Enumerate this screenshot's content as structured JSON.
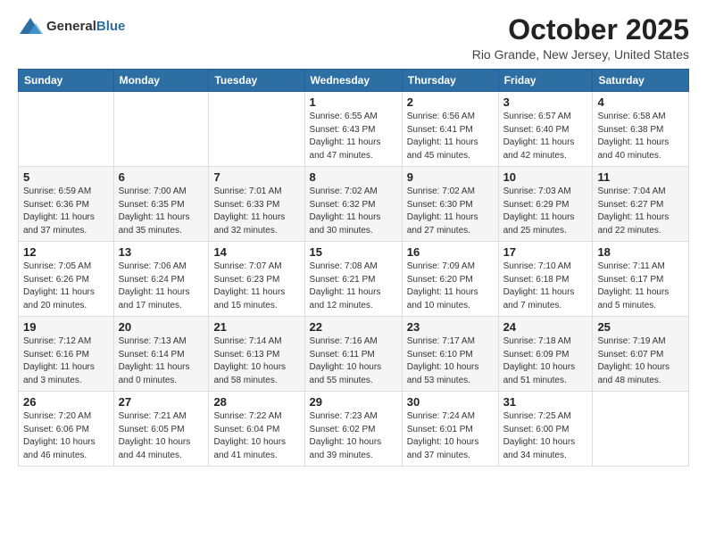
{
  "header": {
    "logo_general": "General",
    "logo_blue": "Blue",
    "title": "October 2025",
    "location": "Rio Grande, New Jersey, United States"
  },
  "weekdays": [
    "Sunday",
    "Monday",
    "Tuesday",
    "Wednesday",
    "Thursday",
    "Friday",
    "Saturday"
  ],
  "weeks": [
    [
      {
        "day": "",
        "info": ""
      },
      {
        "day": "",
        "info": ""
      },
      {
        "day": "",
        "info": ""
      },
      {
        "day": "1",
        "info": "Sunrise: 6:55 AM\nSunset: 6:43 PM\nDaylight: 11 hours\nand 47 minutes."
      },
      {
        "day": "2",
        "info": "Sunrise: 6:56 AM\nSunset: 6:41 PM\nDaylight: 11 hours\nand 45 minutes."
      },
      {
        "day": "3",
        "info": "Sunrise: 6:57 AM\nSunset: 6:40 PM\nDaylight: 11 hours\nand 42 minutes."
      },
      {
        "day": "4",
        "info": "Sunrise: 6:58 AM\nSunset: 6:38 PM\nDaylight: 11 hours\nand 40 minutes."
      }
    ],
    [
      {
        "day": "5",
        "info": "Sunrise: 6:59 AM\nSunset: 6:36 PM\nDaylight: 11 hours\nand 37 minutes."
      },
      {
        "day": "6",
        "info": "Sunrise: 7:00 AM\nSunset: 6:35 PM\nDaylight: 11 hours\nand 35 minutes."
      },
      {
        "day": "7",
        "info": "Sunrise: 7:01 AM\nSunset: 6:33 PM\nDaylight: 11 hours\nand 32 minutes."
      },
      {
        "day": "8",
        "info": "Sunrise: 7:02 AM\nSunset: 6:32 PM\nDaylight: 11 hours\nand 30 minutes."
      },
      {
        "day": "9",
        "info": "Sunrise: 7:02 AM\nSunset: 6:30 PM\nDaylight: 11 hours\nand 27 minutes."
      },
      {
        "day": "10",
        "info": "Sunrise: 7:03 AM\nSunset: 6:29 PM\nDaylight: 11 hours\nand 25 minutes."
      },
      {
        "day": "11",
        "info": "Sunrise: 7:04 AM\nSunset: 6:27 PM\nDaylight: 11 hours\nand 22 minutes."
      }
    ],
    [
      {
        "day": "12",
        "info": "Sunrise: 7:05 AM\nSunset: 6:26 PM\nDaylight: 11 hours\nand 20 minutes."
      },
      {
        "day": "13",
        "info": "Sunrise: 7:06 AM\nSunset: 6:24 PM\nDaylight: 11 hours\nand 17 minutes."
      },
      {
        "day": "14",
        "info": "Sunrise: 7:07 AM\nSunset: 6:23 PM\nDaylight: 11 hours\nand 15 minutes."
      },
      {
        "day": "15",
        "info": "Sunrise: 7:08 AM\nSunset: 6:21 PM\nDaylight: 11 hours\nand 12 minutes."
      },
      {
        "day": "16",
        "info": "Sunrise: 7:09 AM\nSunset: 6:20 PM\nDaylight: 11 hours\nand 10 minutes."
      },
      {
        "day": "17",
        "info": "Sunrise: 7:10 AM\nSunset: 6:18 PM\nDaylight: 11 hours\nand 7 minutes."
      },
      {
        "day": "18",
        "info": "Sunrise: 7:11 AM\nSunset: 6:17 PM\nDaylight: 11 hours\nand 5 minutes."
      }
    ],
    [
      {
        "day": "19",
        "info": "Sunrise: 7:12 AM\nSunset: 6:16 PM\nDaylight: 11 hours\nand 3 minutes."
      },
      {
        "day": "20",
        "info": "Sunrise: 7:13 AM\nSunset: 6:14 PM\nDaylight: 11 hours\nand 0 minutes."
      },
      {
        "day": "21",
        "info": "Sunrise: 7:14 AM\nSunset: 6:13 PM\nDaylight: 10 hours\nand 58 minutes."
      },
      {
        "day": "22",
        "info": "Sunrise: 7:16 AM\nSunset: 6:11 PM\nDaylight: 10 hours\nand 55 minutes."
      },
      {
        "day": "23",
        "info": "Sunrise: 7:17 AM\nSunset: 6:10 PM\nDaylight: 10 hours\nand 53 minutes."
      },
      {
        "day": "24",
        "info": "Sunrise: 7:18 AM\nSunset: 6:09 PM\nDaylight: 10 hours\nand 51 minutes."
      },
      {
        "day": "25",
        "info": "Sunrise: 7:19 AM\nSunset: 6:07 PM\nDaylight: 10 hours\nand 48 minutes."
      }
    ],
    [
      {
        "day": "26",
        "info": "Sunrise: 7:20 AM\nSunset: 6:06 PM\nDaylight: 10 hours\nand 46 minutes."
      },
      {
        "day": "27",
        "info": "Sunrise: 7:21 AM\nSunset: 6:05 PM\nDaylight: 10 hours\nand 44 minutes."
      },
      {
        "day": "28",
        "info": "Sunrise: 7:22 AM\nSunset: 6:04 PM\nDaylight: 10 hours\nand 41 minutes."
      },
      {
        "day": "29",
        "info": "Sunrise: 7:23 AM\nSunset: 6:02 PM\nDaylight: 10 hours\nand 39 minutes."
      },
      {
        "day": "30",
        "info": "Sunrise: 7:24 AM\nSunset: 6:01 PM\nDaylight: 10 hours\nand 37 minutes."
      },
      {
        "day": "31",
        "info": "Sunrise: 7:25 AM\nSunset: 6:00 PM\nDaylight: 10 hours\nand 34 minutes."
      },
      {
        "day": "",
        "info": ""
      }
    ]
  ]
}
